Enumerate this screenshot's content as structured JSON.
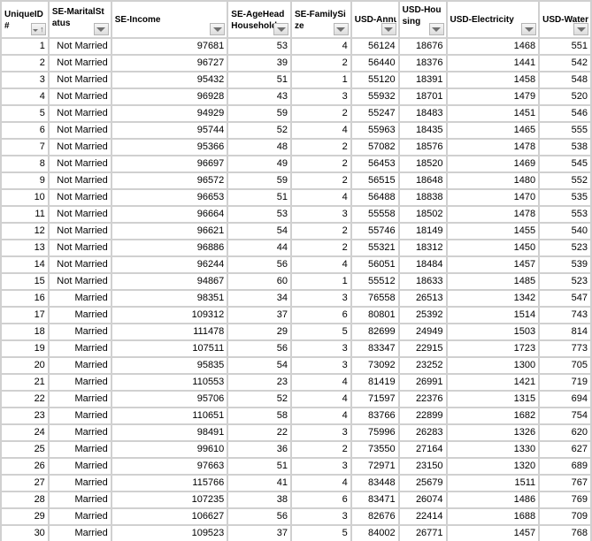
{
  "columns": [
    {
      "key": "id",
      "label": "UniqueID#",
      "filter": "sorted-ascending"
    },
    {
      "key": "marital",
      "label": "SE-MaritalStatus",
      "filter": "filter"
    },
    {
      "key": "income",
      "label": "SE-Income",
      "filter": "filter"
    },
    {
      "key": "age",
      "label": "SE-AgeHeadHousehold",
      "filter": "filter"
    },
    {
      "key": "family",
      "label": "SE-FamilySize",
      "filter": "filter"
    },
    {
      "key": "annual",
      "label": "USD-Annual",
      "filter": "filter"
    },
    {
      "key": "housing",
      "label": "USD-Housing",
      "filter": "filter"
    },
    {
      "key": "electricity",
      "label": "USD-Electricity",
      "filter": "filter"
    },
    {
      "key": "water",
      "label": "USD-Water",
      "filter": "filter"
    }
  ],
  "icons": {
    "filter": "dropdown-triangle-icon",
    "sort": "sort-ascending-arrow-icon"
  },
  "rows": [
    [
      "1",
      "Not Married",
      "97681",
      "53",
      "4",
      "56124",
      "18676",
      "1468",
      "551"
    ],
    [
      "2",
      "Not Married",
      "96727",
      "39",
      "2",
      "56440",
      "18376",
      "1441",
      "542"
    ],
    [
      "3",
      "Not Married",
      "95432",
      "51",
      "1",
      "55120",
      "18391",
      "1458",
      "548"
    ],
    [
      "4",
      "Not Married",
      "96928",
      "43",
      "3",
      "55932",
      "18701",
      "1479",
      "520"
    ],
    [
      "5",
      "Not Married",
      "94929",
      "59",
      "2",
      "55247",
      "18483",
      "1451",
      "546"
    ],
    [
      "6",
      "Not Married",
      "95744",
      "52",
      "4",
      "55963",
      "18435",
      "1465",
      "555"
    ],
    [
      "7",
      "Not Married",
      "95366",
      "48",
      "2",
      "57082",
      "18576",
      "1478",
      "538"
    ],
    [
      "8",
      "Not Married",
      "96697",
      "49",
      "2",
      "56453",
      "18520",
      "1469",
      "545"
    ],
    [
      "9",
      "Not Married",
      "96572",
      "59",
      "2",
      "56515",
      "18648",
      "1480",
      "552"
    ],
    [
      "10",
      "Not Married",
      "96653",
      "51",
      "4",
      "56488",
      "18838",
      "1470",
      "535"
    ],
    [
      "11",
      "Not Married",
      "96664",
      "53",
      "3",
      "55558",
      "18502",
      "1478",
      "553"
    ],
    [
      "12",
      "Not Married",
      "96621",
      "54",
      "2",
      "55746",
      "18149",
      "1455",
      "540"
    ],
    [
      "13",
      "Not Married",
      "96886",
      "44",
      "2",
      "55321",
      "18312",
      "1450",
      "523"
    ],
    [
      "14",
      "Not Married",
      "96244",
      "56",
      "4",
      "56051",
      "18484",
      "1457",
      "539"
    ],
    [
      "15",
      "Not Married",
      "94867",
      "60",
      "1",
      "55512",
      "18633",
      "1485",
      "523"
    ],
    [
      "16",
      "Married",
      "98351",
      "34",
      "3",
      "76558",
      "26513",
      "1342",
      "547"
    ],
    [
      "17",
      "Married",
      "109312",
      "37",
      "6",
      "80801",
      "25392",
      "1514",
      "743"
    ],
    [
      "18",
      "Married",
      "111478",
      "29",
      "5",
      "82699",
      "24949",
      "1503",
      "814"
    ],
    [
      "19",
      "Married",
      "107511",
      "56",
      "3",
      "83347",
      "22915",
      "1723",
      "773"
    ],
    [
      "20",
      "Married",
      "95835",
      "54",
      "3",
      "73092",
      "23252",
      "1300",
      "705"
    ],
    [
      "21",
      "Married",
      "110553",
      "23",
      "4",
      "81419",
      "26991",
      "1421",
      "719"
    ],
    [
      "22",
      "Married",
      "95706",
      "52",
      "4",
      "71597",
      "22376",
      "1315",
      "694"
    ],
    [
      "23",
      "Married",
      "110651",
      "58",
      "4",
      "83766",
      "22899",
      "1682",
      "754"
    ],
    [
      "24",
      "Married",
      "98491",
      "22",
      "3",
      "75996",
      "26283",
      "1326",
      "620"
    ],
    [
      "25",
      "Married",
      "99610",
      "36",
      "2",
      "73550",
      "27164",
      "1330",
      "627"
    ],
    [
      "26",
      "Married",
      "97663",
      "51",
      "3",
      "72971",
      "23150",
      "1320",
      "689"
    ],
    [
      "27",
      "Married",
      "115766",
      "41",
      "4",
      "83448",
      "25679",
      "1511",
      "767"
    ],
    [
      "28",
      "Married",
      "107235",
      "38",
      "6",
      "83471",
      "26074",
      "1486",
      "769"
    ],
    [
      "29",
      "Married",
      "106627",
      "56",
      "3",
      "82676",
      "22414",
      "1688",
      "709"
    ],
    [
      "30",
      "Married",
      "109523",
      "37",
      "5",
      "84002",
      "26771",
      "1457",
      "768"
    ]
  ]
}
